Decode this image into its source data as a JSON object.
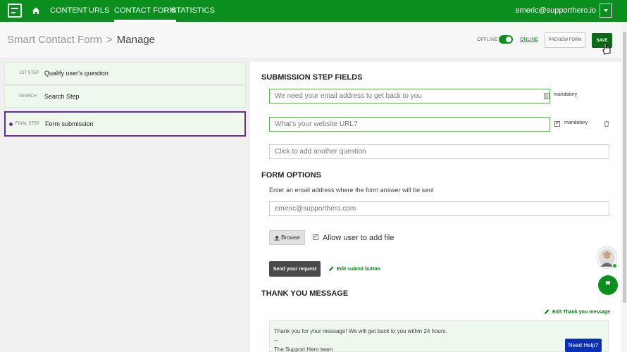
{
  "topnav": {
    "items": [
      {
        "label": "CONTENT"
      },
      {
        "label": "URLS"
      },
      {
        "label": "CONTACT FORM"
      },
      {
        "label": "STATISTICS"
      }
    ],
    "active": "CONTACT FORM",
    "user_email": "emeric@supporthero.io"
  },
  "header": {
    "breadcrumb_parent": "Smart Contact Form",
    "breadcrumb_separator": ">",
    "breadcrumb_current": "Manage",
    "offline_label": "OFFLINE",
    "online_label": "ONLINE",
    "preview_label": "PREVIEW FORM",
    "save_label": "SAVE"
  },
  "steps": [
    {
      "tag": "1ST STEP",
      "name": "Qualify user's question"
    },
    {
      "tag": "SEARCH",
      "name": "Search Step"
    },
    {
      "tag": "FINAL STEP",
      "name": "Form submission",
      "active": true
    }
  ],
  "submission": {
    "title": "SUBMISSION STEP FIELDS",
    "fields": [
      {
        "value": "We need your email address to get back to you",
        "mandatory_label": "mandatory"
      },
      {
        "value": "What's your website URL?",
        "mandatory_label": "mandatory",
        "checked": true
      }
    ],
    "add_placeholder": "Click to add another question"
  },
  "form_options": {
    "title": "FORM OPTIONS",
    "email_hint": "Enter an email address where the form answer will be sent",
    "email_value": "emeric@supporthero.com",
    "browse_label": "Browse",
    "allow_file_label": "Allow user to add file",
    "send_button": "Send your request",
    "edit_submit_label": "Edit submit button"
  },
  "thank_you": {
    "title": "THANK YOU MESSAGE",
    "edit_label": "Edit Thank you message",
    "line1": "Thank you for your message! We will get back to you within 24 hours.",
    "line2": "--",
    "line3": "The Support Hero team"
  },
  "widgets": {
    "help_label": "Need Help?"
  },
  "colors": {
    "brand_green": "#0a8f1e",
    "dark_green": "#0a6a16",
    "active_purple": "#6a2c91",
    "help_blue": "#0a2fb5"
  }
}
